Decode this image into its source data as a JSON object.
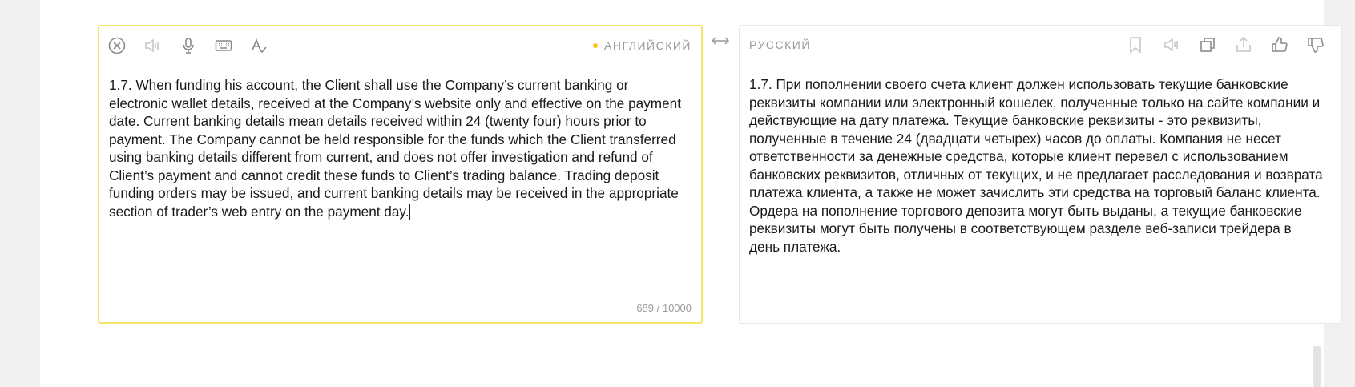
{
  "source": {
    "language": "АНГЛИЙСКИЙ",
    "text": "1.7. When funding his account, the Client shall use the Company’s current banking or electronic wallet details, received at the Company’s website only and effective on the payment date. Current banking details mean details received within 24 (twenty four) hours prior to payment. The Company cannot be held responsible for the funds which the Client transferred using banking details different from current, and does not offer investigation and refund of Client’s payment and cannot credit these funds to Client’s trading balance. Trading deposit funding orders may be issued, and current banking details may be received in the appropriate section of trader’s web entry on the payment day.",
    "counter": "689 / 10000",
    "accent_color": "#f6e36a",
    "icons": [
      "clear-icon",
      "speaker-icon",
      "microphone-icon",
      "keyboard-icon",
      "spellcheck-icon"
    ]
  },
  "target": {
    "language": "РУССКИЙ",
    "text": "1.7. При пополнении своего счета клиент должен использовать текущие банковские реквизиты компании или электронный кошелек, полученные только на сайте компании и действующие на дату платежа. Текущие банковские реквизиты - это реквизиты, полученные в течение 24 (двадцати четырех) часов до оплаты. Компания не несет ответственности за денежные средства, которые клиент перевел с использованием банковских реквизитов, отличных от текущих, и не предлагает расследования и возврата платежа клиента, а также не может зачислить эти средства на торговый баланс клиента. Ордера на пополнение торгового депозита могут быть выданы, а текущие банковские реквизиты могут быть получены в соответствующем разделе веб-записи трейдера в день платежа.",
    "icons": [
      "bookmark-icon",
      "speaker-icon",
      "copy-icon",
      "share-icon",
      "thumbs-up-icon",
      "thumbs-down-icon"
    ]
  },
  "swap_icon": "swap-arrows-icon"
}
